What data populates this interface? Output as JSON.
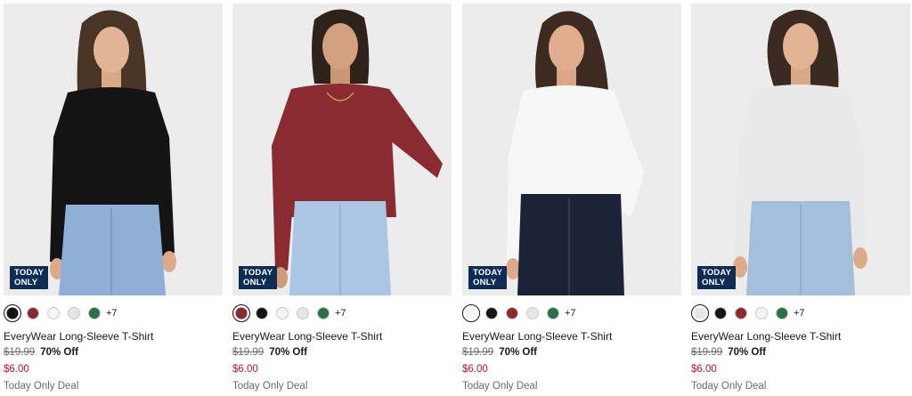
{
  "products": [
    {
      "badge": [
        "TODAY",
        "ONLY"
      ],
      "name": "EveryWear Long-Sleeve T-Shirt",
      "original_price": "$19.99",
      "discount": "70% Off",
      "sale_price": "$6.00",
      "deal_label": "Today Only Deal",
      "more_colors": "+7",
      "selected_swatch": 0,
      "shirt_color": "#141414",
      "jeans_color": "#8fb0d6",
      "swatches": [
        {
          "name": "black",
          "color": "#141414"
        },
        {
          "name": "burgundy",
          "color": "#8a2b31"
        },
        {
          "name": "white",
          "color": "#f4f4f4"
        },
        {
          "name": "light-heather",
          "color": "#e6e6e6"
        },
        {
          "name": "green",
          "color": "#2e6e4a"
        }
      ]
    },
    {
      "badge": [
        "TODAY",
        "ONLY"
      ],
      "name": "EveryWear Long-Sleeve T-Shirt",
      "original_price": "$19.99",
      "discount": "70% Off",
      "sale_price": "$6.00",
      "deal_label": "Today Only Deal",
      "more_colors": "+7",
      "selected_swatch": 0,
      "shirt_color": "#8a2b31",
      "jeans_color": "#a9c6e3",
      "swatches": [
        {
          "name": "burgundy",
          "color": "#8a2b31"
        },
        {
          "name": "black",
          "color": "#141414"
        },
        {
          "name": "white",
          "color": "#f4f4f4"
        },
        {
          "name": "light-heather",
          "color": "#e6e6e6"
        },
        {
          "name": "green",
          "color": "#2e6e4a"
        }
      ]
    },
    {
      "badge": [
        "TODAY",
        "ONLY"
      ],
      "name": "EveryWear Long-Sleeve T-Shirt",
      "original_price": "$19.99",
      "discount": "70% Off",
      "sale_price": "$6.00",
      "deal_label": "Today Only Deal",
      "more_colors": "+7",
      "selected_swatch": 0,
      "shirt_color": "#f7f7f7",
      "jeans_color": "#1c2336",
      "swatches": [
        {
          "name": "white",
          "color": "#f4f4f4"
        },
        {
          "name": "black",
          "color": "#141414"
        },
        {
          "name": "burgundy",
          "color": "#8a2b31"
        },
        {
          "name": "light-heather",
          "color": "#e6e6e6"
        },
        {
          "name": "green",
          "color": "#2e6e4a"
        }
      ]
    },
    {
      "badge": [
        "TODAY",
        "ONLY"
      ],
      "name": "EveryWear Long-Sleeve T-Shirt",
      "original_price": "$19.99",
      "discount": "70% Off",
      "sale_price": "$6.00",
      "deal_label": "Today Only Deal",
      "more_colors": "+7",
      "selected_swatch": 0,
      "shirt_color": "#e9e9e9",
      "jeans_color": "#a3bfdc",
      "swatches": [
        {
          "name": "light-heather",
          "color": "#e6e6e6"
        },
        {
          "name": "black",
          "color": "#141414"
        },
        {
          "name": "burgundy",
          "color": "#8a2b31"
        },
        {
          "name": "white",
          "color": "#f4f4f4"
        },
        {
          "name": "green",
          "color": "#2e6e4a"
        }
      ]
    }
  ],
  "colors": {
    "badge_bg": "#0f2c55",
    "sale_red": "#c8102e",
    "muted_text": "#6b6b6b",
    "photo_bg": "#ececec"
  }
}
